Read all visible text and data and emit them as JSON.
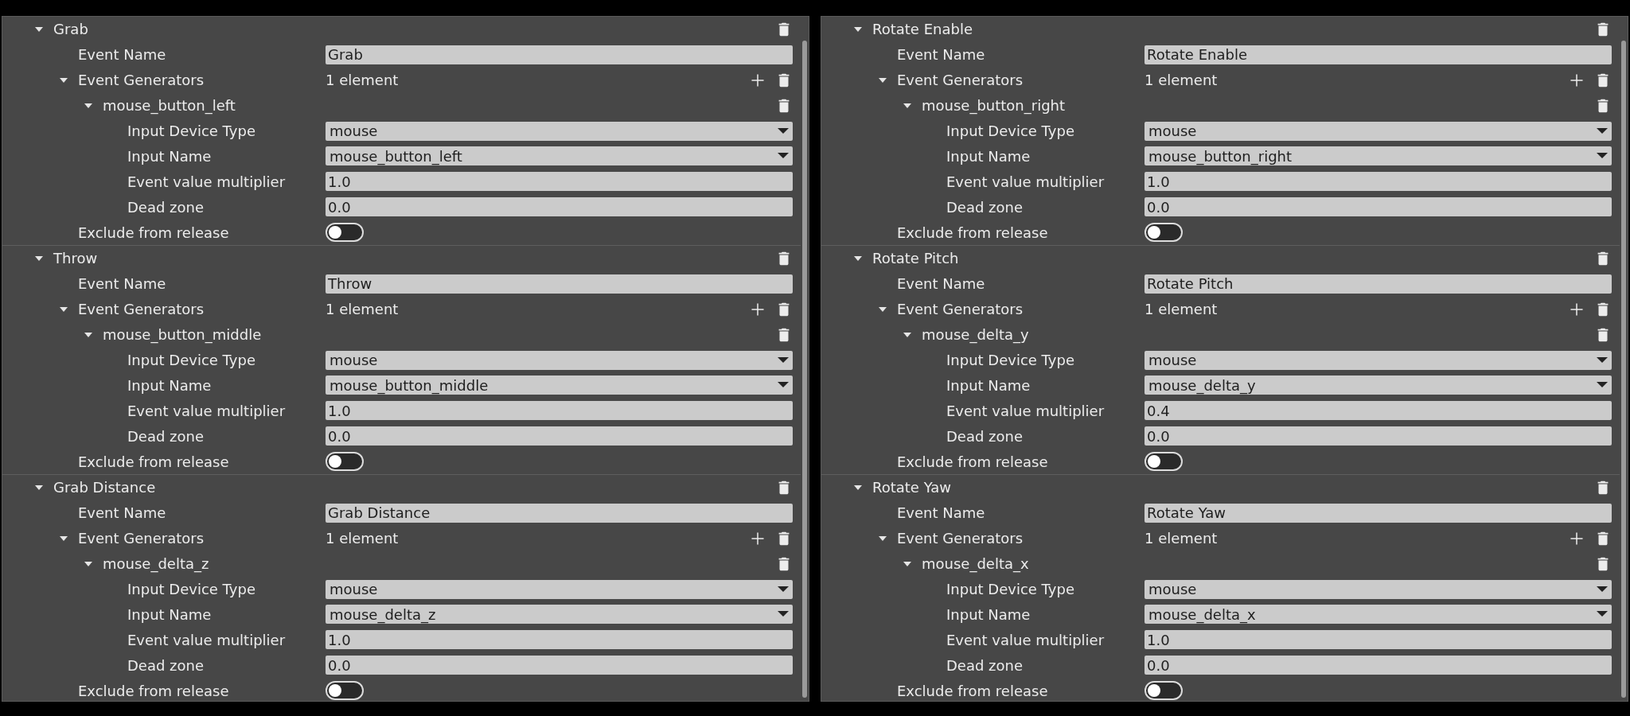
{
  "panels": [
    {
      "sections": [
        {
          "title": "Grab",
          "expanded": true,
          "rows": [
            {
              "kind": "text",
              "label": "Event Name",
              "value": "Grab"
            },
            {
              "kind": "list",
              "label": "Event Generators",
              "value": "1 element",
              "expanded": true,
              "children": [
                {
                  "kind": "item",
                  "label": "mouse_button_left",
                  "expanded": true,
                  "children": [
                    {
                      "kind": "dropdown",
                      "label": "Input Device Type",
                      "value": "mouse"
                    },
                    {
                      "kind": "dropdown",
                      "label": "Input Name",
                      "value": "mouse_button_left"
                    },
                    {
                      "kind": "text",
                      "label": "Event value multiplier",
                      "value": "1.0"
                    },
                    {
                      "kind": "text",
                      "label": "Dead zone",
                      "value": "0.0"
                    }
                  ]
                }
              ]
            },
            {
              "kind": "toggle",
              "label": "Exclude from release",
              "on": false
            }
          ]
        },
        {
          "title": "Throw",
          "expanded": true,
          "rows": [
            {
              "kind": "text",
              "label": "Event Name",
              "value": "Throw"
            },
            {
              "kind": "list",
              "label": "Event Generators",
              "value": "1 element",
              "expanded": true,
              "children": [
                {
                  "kind": "item",
                  "label": "mouse_button_middle",
                  "expanded": true,
                  "children": [
                    {
                      "kind": "dropdown",
                      "label": "Input Device Type",
                      "value": "mouse"
                    },
                    {
                      "kind": "dropdown",
                      "label": "Input Name",
                      "value": "mouse_button_middle"
                    },
                    {
                      "kind": "text",
                      "label": "Event value multiplier",
                      "value": "1.0"
                    },
                    {
                      "kind": "text",
                      "label": "Dead zone",
                      "value": "0.0"
                    }
                  ]
                }
              ]
            },
            {
              "kind": "toggle",
              "label": "Exclude from release",
              "on": false
            }
          ]
        },
        {
          "title": "Grab Distance",
          "expanded": true,
          "rows": [
            {
              "kind": "text",
              "label": "Event Name",
              "value": "Grab Distance"
            },
            {
              "kind": "list",
              "label": "Event Generators",
              "value": "1 element",
              "expanded": true,
              "children": [
                {
                  "kind": "item",
                  "label": "mouse_delta_z",
                  "expanded": true,
                  "children": [
                    {
                      "kind": "dropdown",
                      "label": "Input Device Type",
                      "value": "mouse"
                    },
                    {
                      "kind": "dropdown",
                      "label": "Input Name",
                      "value": "mouse_delta_z"
                    },
                    {
                      "kind": "text",
                      "label": "Event value multiplier",
                      "value": "1.0"
                    },
                    {
                      "kind": "text",
                      "label": "Dead zone",
                      "value": "0.0"
                    }
                  ]
                }
              ]
            },
            {
              "kind": "toggle",
              "label": "Exclude from release",
              "on": false
            }
          ]
        }
      ]
    },
    {
      "sections": [
        {
          "title": "Rotate Enable",
          "expanded": true,
          "rows": [
            {
              "kind": "text",
              "label": "Event Name",
              "value": "Rotate Enable"
            },
            {
              "kind": "list",
              "label": "Event Generators",
              "value": "1 element",
              "expanded": true,
              "children": [
                {
                  "kind": "item",
                  "label": "mouse_button_right",
                  "expanded": true,
                  "children": [
                    {
                      "kind": "dropdown",
                      "label": "Input Device Type",
                      "value": "mouse"
                    },
                    {
                      "kind": "dropdown",
                      "label": "Input Name",
                      "value": "mouse_button_right"
                    },
                    {
                      "kind": "text",
                      "label": "Event value multiplier",
                      "value": "1.0"
                    },
                    {
                      "kind": "text",
                      "label": "Dead zone",
                      "value": "0.0"
                    }
                  ]
                }
              ]
            },
            {
              "kind": "toggle",
              "label": "Exclude from release",
              "on": false
            }
          ]
        },
        {
          "title": "Rotate Pitch",
          "expanded": true,
          "rows": [
            {
              "kind": "text",
              "label": "Event Name",
              "value": "Rotate Pitch"
            },
            {
              "kind": "list",
              "label": "Event Generators",
              "value": "1 element",
              "expanded": true,
              "children": [
                {
                  "kind": "item",
                  "label": "mouse_delta_y",
                  "expanded": true,
                  "children": [
                    {
                      "kind": "dropdown",
                      "label": "Input Device Type",
                      "value": "mouse"
                    },
                    {
                      "kind": "dropdown",
                      "label": "Input Name",
                      "value": "mouse_delta_y"
                    },
                    {
                      "kind": "text",
                      "label": "Event value multiplier",
                      "value": "0.4"
                    },
                    {
                      "kind": "text",
                      "label": "Dead zone",
                      "value": "0.0"
                    }
                  ]
                }
              ]
            },
            {
              "kind": "toggle",
              "label": "Exclude from release",
              "on": false
            }
          ]
        },
        {
          "title": "Rotate Yaw",
          "expanded": true,
          "rows": [
            {
              "kind": "text",
              "label": "Event Name",
              "value": "Rotate Yaw"
            },
            {
              "kind": "list",
              "label": "Event Generators",
              "value": "1 element",
              "expanded": true,
              "children": [
                {
                  "kind": "item",
                  "label": "mouse_delta_x",
                  "expanded": true,
                  "children": [
                    {
                      "kind": "dropdown",
                      "label": "Input Device Type",
                      "value": "mouse"
                    },
                    {
                      "kind": "dropdown",
                      "label": "Input Name",
                      "value": "mouse_delta_x"
                    },
                    {
                      "kind": "text",
                      "label": "Event value multiplier",
                      "value": "1.0"
                    },
                    {
                      "kind": "text",
                      "label": "Dead zone",
                      "value": "0.0"
                    }
                  ]
                }
              ]
            },
            {
              "kind": "toggle",
              "label": "Exclude from release",
              "on": false
            }
          ]
        }
      ]
    }
  ]
}
